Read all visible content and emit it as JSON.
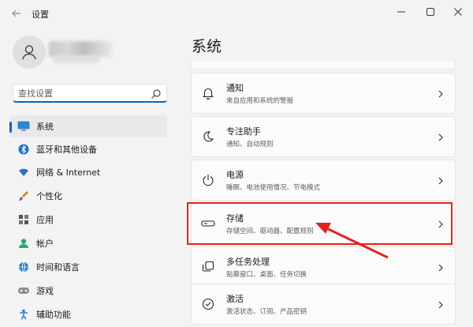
{
  "window": {
    "title": "设置"
  },
  "search": {
    "placeholder": "查找设置"
  },
  "nav": [
    {
      "label": "系统",
      "icon": "monitor-icon",
      "active": true
    },
    {
      "label": "蓝牙和其他设备",
      "icon": "bluetooth-icon"
    },
    {
      "label": "网络 & Internet",
      "icon": "wifi-icon"
    },
    {
      "label": "个性化",
      "icon": "brush-icon"
    },
    {
      "label": "应用",
      "icon": "apps-icon"
    },
    {
      "label": "帐户",
      "icon": "account-icon"
    },
    {
      "label": "时间和语言",
      "icon": "globe-clock-icon"
    },
    {
      "label": "游戏",
      "icon": "gamepad-icon"
    },
    {
      "label": "辅助功能",
      "icon": "accessibility-icon"
    }
  ],
  "main": {
    "title": "系统",
    "cards": [
      {
        "title": "通知",
        "subtitle": "来自应用和系统的警报",
        "icon": "bell-icon"
      },
      {
        "title": "专注助手",
        "subtitle": "通知、自动规则",
        "icon": "moon-icon"
      },
      {
        "title": "电源",
        "subtitle": "睡眠、电池使用情况、节电模式",
        "icon": "power-icon"
      },
      {
        "title": "存储",
        "subtitle": "存储空间、驱动器、配置规则",
        "icon": "storage-icon"
      },
      {
        "title": "多任务处理",
        "subtitle": "贴靠窗口、桌面、任务切换",
        "icon": "multitask-icon"
      },
      {
        "title": "激活",
        "subtitle": "激活状态、订阅、产品密钥",
        "icon": "check-circle-icon"
      }
    ]
  },
  "colors": {
    "accent": "#0067c0",
    "annotation": "#e3231f"
  }
}
